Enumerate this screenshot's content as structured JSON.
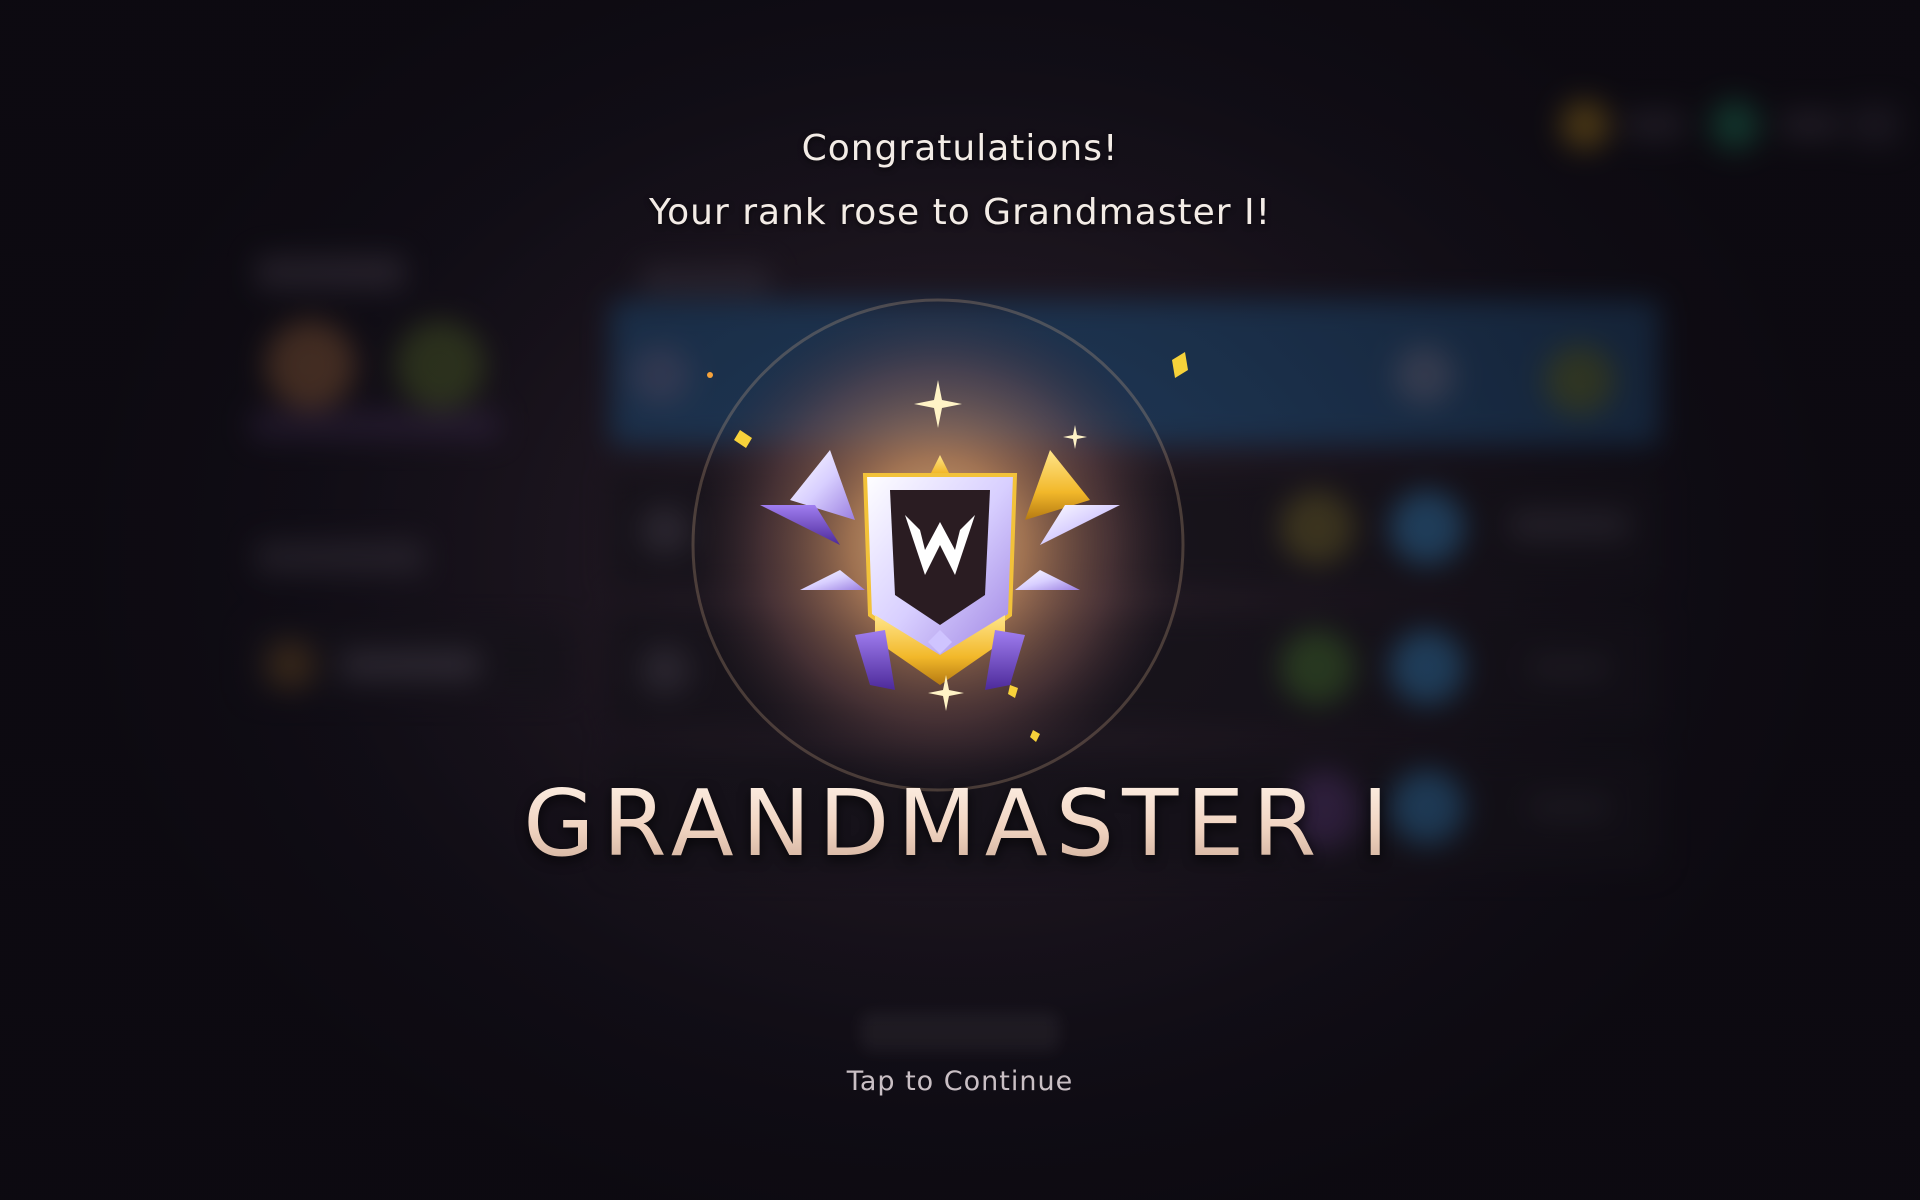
{
  "overlay": {
    "title": "Congratulations!",
    "subtitle": "Your rank rose to Grandmaster I!",
    "rank_name": "GRANDMASTER I",
    "continue_label": "Tap to Continue"
  },
  "rank_badge": {
    "icon": "grandmaster-rank-emblem-icon",
    "glow_color": "#d9a86a",
    "gold": "#f2c23a",
    "purple": "#7a4fd0",
    "crystal": "#e9e4ff"
  },
  "colors": {
    "background": "#14101a",
    "text": "#f3ece6",
    "rank_text": "#f1dccd",
    "hint_text": "#c9bfc4"
  }
}
